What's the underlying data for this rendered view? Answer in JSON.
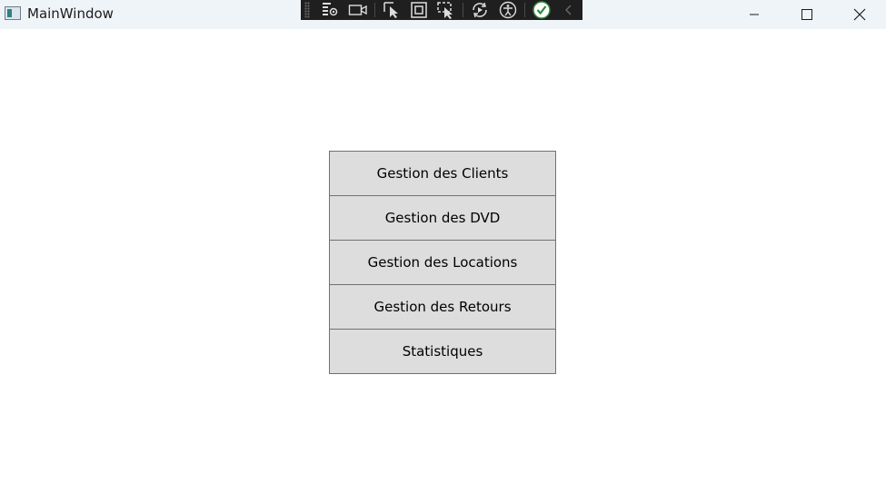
{
  "window": {
    "title": "MainWindow",
    "controls": [
      "minimize-icon",
      "maximize-icon",
      "close-icon"
    ]
  },
  "debug_toolbar": {
    "icons": [
      "live-visual-tree-icon",
      "record-icon",
      "select-element-icon",
      "display-layout-adorners-icon",
      "track-focus-icon",
      "hot-reload-icon",
      "accessibility-icon",
      "check-icon",
      "collapse-chevron-icon"
    ]
  },
  "menu": {
    "items": [
      {
        "label": "Gestion des Clients"
      },
      {
        "label": "Gestion des DVD"
      },
      {
        "label": "Gestion des Locations"
      },
      {
        "label": "Gestion des Retours"
      },
      {
        "label": "Statistiques"
      }
    ]
  }
}
